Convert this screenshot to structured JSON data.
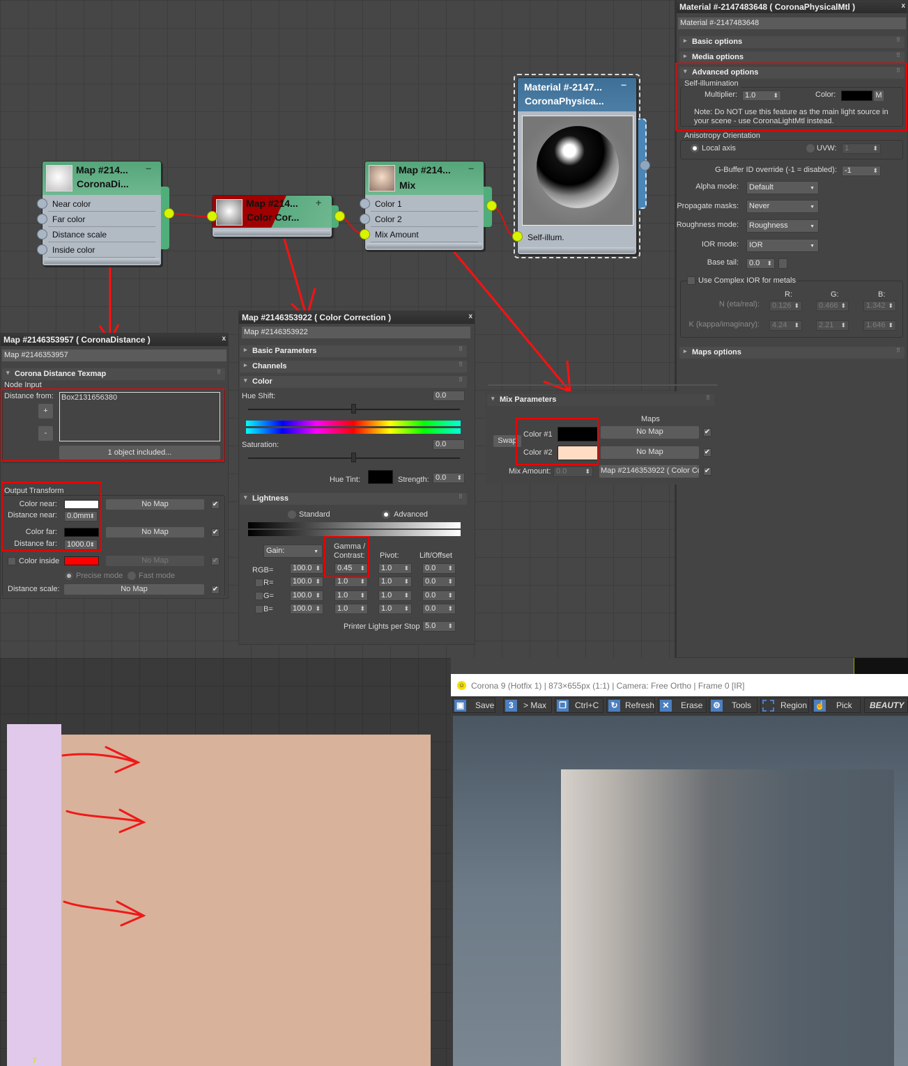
{
  "node_editor": {
    "nodes": {
      "distance": {
        "title1": "Map #214...",
        "title2": "CoronaDi...",
        "inputs": [
          "Near color",
          "Far color",
          "Distance scale",
          "Inside color"
        ],
        "collapse": "−"
      },
      "color_correction": {
        "title1": "Map #214...",
        "title2": "Color Cor...",
        "expand": "+"
      },
      "mix": {
        "title1": "Map #214...",
        "title2": "Mix",
        "inputs": [
          "Color 1",
          "Color 2",
          "Mix Amount"
        ],
        "collapse": "−"
      },
      "material": {
        "title1": "Material #-2147...",
        "title2": "CoronaPhysica...",
        "input": "Self-illum.",
        "collapse": "−"
      }
    }
  },
  "material_panel": {
    "title": "Material #-2147483648  ( CoronaPhysicalMtl )",
    "close": "x",
    "name": "Material #-2147483648",
    "rollouts": {
      "basic": "Basic options",
      "media": "Media options",
      "advanced": "Advanced options",
      "maps": "Maps options"
    },
    "self_illum": {
      "group": "Self-illumination",
      "multiplier_label": "Multiplier:",
      "multiplier": "1.0",
      "color_label": "Color:",
      "color": "#000000",
      "map_button": "M",
      "note_line1": "Note: Do NOT use this feature as the main light source in",
      "note_line2": "your scene - use CoronaLightMtl instead."
    },
    "anisotropy": {
      "group": "Anisotropy Orientation",
      "local_axis": "Local axis",
      "uvw_label": "UVW:",
      "uvw": "1"
    },
    "gbuffer": {
      "label": "G-Buffer ID override (-1 = disabled):",
      "value": "-1"
    },
    "alpha_mode": {
      "label": "Alpha mode:",
      "value": "Default"
    },
    "propagate_masks": {
      "label": "Propagate masks:",
      "value": "Never"
    },
    "roughness_mode": {
      "label": "Roughness mode:",
      "value": "Roughness"
    },
    "ior_mode": {
      "label": "IOR mode:",
      "value": "IOR"
    },
    "base_tail": {
      "label": "Base tail:",
      "value": "0.0"
    },
    "complex_ior": {
      "label": "Use Complex IOR for metals",
      "r": "R:",
      "g": "G:",
      "b": "B:",
      "n_label": "N (eta/real):",
      "n": [
        "0.126",
        "0.466",
        "1.342"
      ],
      "k_label": "K (kappa/imaginary):",
      "k": [
        "4.24",
        "2.21",
        "1.646"
      ]
    }
  },
  "distance_panel": {
    "title": "Map #2146353957  ( CoronaDistance )",
    "close": "x",
    "name": "Map #2146353957",
    "rollout": "Corona Distance Texmap",
    "node_input": "Node Input",
    "distance_from_label": "Distance from:",
    "distance_from_items": [
      "Box2131656380"
    ],
    "add": "+",
    "remove": "-",
    "included": "1 object included...",
    "output_transform": "Output Transform",
    "color_near_label": "Color near:",
    "color_near": "#ffffff",
    "distance_near_label": "Distance near:",
    "distance_near": "0.0mm",
    "color_far_label": "Color far:",
    "color_far": "#000000",
    "distance_far_label": "Distance far:",
    "distance_far": "1000.0",
    "color_inside_label": "Color inside",
    "color_inside": "#ff0000",
    "no_map": "No Map",
    "precise_mode": "Precise mode",
    "fast_mode": "Fast mode",
    "distance_scale_label": "Distance scale:"
  },
  "cc_panel": {
    "title": "Map #2146353922  ( Color Correction )",
    "close": "x",
    "name": "Map #2146353922",
    "rollouts": {
      "basic": "Basic Parameters",
      "channels": "Channels",
      "color": "Color",
      "lightness": "Lightness"
    },
    "hue_shift_label": "Hue Shift:",
    "hue_shift": "0.0",
    "hue_shift_slider": 0.5,
    "saturation_label": "Saturation:",
    "saturation": "0.0",
    "saturation_slider": 0.5,
    "hue_tint_label": "Hue Tint:",
    "hue_tint": "#000000",
    "strength_label": "Strength:",
    "strength": "0.0",
    "standard": "Standard",
    "advanced": "Advanced",
    "gain": "Gain:",
    "gamma_label1": "Gamma /",
    "gamma_label2": "Contrast:",
    "pivot": "Pivot:",
    "lift": "Lift/Offset",
    "rows": [
      {
        "label": "RGB=",
        "gain": "100.0",
        "gamma": "0.45",
        "pivot": "1.0",
        "lift": "0.0"
      },
      {
        "label": "R=",
        "gain": "100.0",
        "gamma": "1.0",
        "pivot": "1.0",
        "lift": "0.0"
      },
      {
        "label": "G=",
        "gain": "100.0",
        "gamma": "1.0",
        "pivot": "1.0",
        "lift": "0.0"
      },
      {
        "label": "B=",
        "gain": "100.0",
        "gamma": "1.0",
        "pivot": "1.0",
        "lift": "0.0"
      }
    ],
    "printer_label": "Printer Lights per Stop",
    "printer": "5.0"
  },
  "mix_panel": {
    "rollout": "Mix Parameters",
    "maps_label": "Maps",
    "swap": "Swap",
    "color1_label": "Color #1",
    "color1": "#000000",
    "color2_label": "Color #2",
    "color2": "#ffdcc4",
    "no_map": "No Map",
    "mix_amount_label": "Mix Amount:",
    "mix_amount": "0.0",
    "mix_map": "Map #2146353922  ( Color Correction )"
  },
  "vfb": {
    "title": "Corona 9 (Hotfix 1) | 873×655px (1:1) | Camera: Free Ortho | Frame 0 [IR]",
    "buttons": [
      "Save",
      "> Max",
      "Ctrl+C",
      "Refresh",
      "Erase",
      "Tools",
      "Region",
      "Pick"
    ],
    "pass": "BEAUTY"
  },
  "viewport": {
    "axis_label": "y"
  }
}
